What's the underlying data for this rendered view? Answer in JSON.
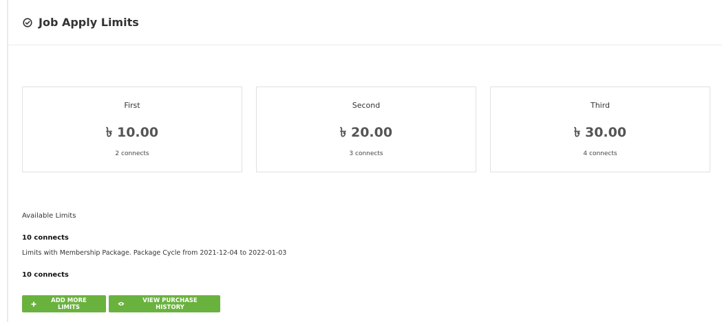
{
  "header": {
    "title": "Job Apply Limits",
    "icon": "check-circle-icon"
  },
  "packages": [
    {
      "name": "First",
      "price": "৳ 10.00",
      "connects": "2 connects"
    },
    {
      "name": "Second",
      "price": "৳ 20.00",
      "connects": "3 connects"
    },
    {
      "name": "Third",
      "price": "৳ 30.00",
      "connects": "4 connects"
    }
  ],
  "available": {
    "label": "Available Limits",
    "membership_connects": "10 connects",
    "package_text": "Limits with Membership Package. Package Cycle from 2021-12-04 to 2022-01-03",
    "total_connects": "10 connects"
  },
  "actions": {
    "add_label": "ADD MORE LIMITS",
    "add_icon": "plus-icon",
    "history_label": "VIEW PURCHASE HISTORY",
    "history_icon": "eye-icon"
  },
  "colors": {
    "button_green": "#6ab23e",
    "card_border": "#e0e0e0"
  }
}
